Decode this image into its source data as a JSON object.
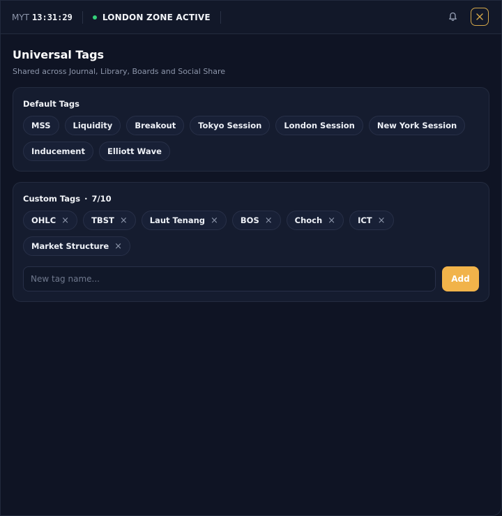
{
  "topbar": {
    "timezone_label": "MYT",
    "time": "13:31:29",
    "status": "LONDON ZONE ACTIVE",
    "status_color": "#34d17a"
  },
  "page": {
    "title": "Universal Tags",
    "subtitle": "Shared across Journal, Library, Boards and Social Share"
  },
  "default_tags": {
    "title": "Default Tags",
    "items": [
      "MSS",
      "Liquidity",
      "Breakout",
      "Tokyo Session",
      "London Session",
      "New York Session",
      "Inducement",
      "Elliott Wave"
    ]
  },
  "custom_tags": {
    "title": "Custom Tags",
    "separator": "·",
    "count": "7/10",
    "items": [
      "OHLC",
      "TBST",
      "Laut Tenang",
      "BOS",
      "Choch",
      "ICT",
      "Market Structure"
    ],
    "remove_glyph": "×",
    "input_placeholder": "New tag name...",
    "add_label": "Add",
    "accent": "#f1b34a"
  },
  "icons": {
    "bell": "bell-icon",
    "close": "close-icon"
  }
}
